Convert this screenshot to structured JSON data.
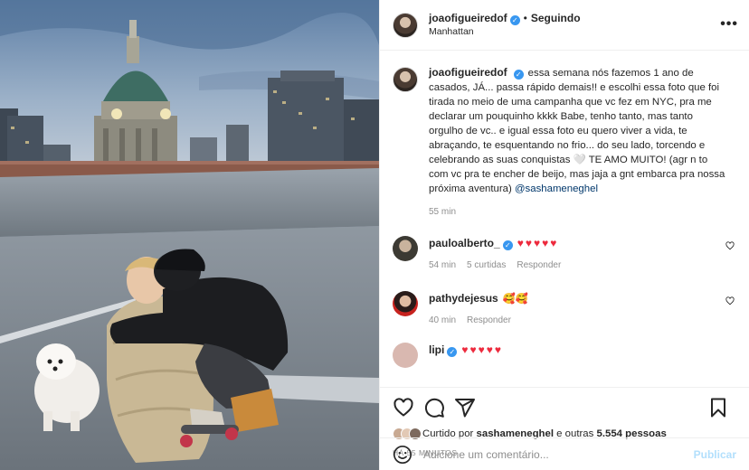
{
  "header": {
    "username": "joaofigueiredof",
    "separator": "•",
    "follow_status": "Seguindo",
    "location": "Manhattan",
    "more": "•••"
  },
  "caption": {
    "username": "joaofigueiredof",
    "text": "essa semana nós fazemos 1 ano de casados, JÁ... passa rápido demais!! e escolhi essa foto que foi tirada no meio de uma campanha que vc fez em NYC, pra me declarar um pouquinho kkkk Babe, tenho tanto, mas tanto orgulho de vc.. e igual essa foto eu quero viver a vida, te abraçando, te esquentando no frio... do seu lado, torcendo e celebrando as suas conquistas 🤍 TE AMO MUITO! (agr n to com vc pra te encher de beijo, mas jaja a gnt embarca pra nossa próxima aventura)",
    "mention": "@sashameneghel",
    "time": "55 min"
  },
  "comments": [
    {
      "username": "pauloalberto_",
      "text": "♥♥♥♥♥",
      "time": "54 min",
      "likes": "5 curtidas",
      "reply": "Responder"
    },
    {
      "username": "pathydejesus",
      "text": "🥰🥰",
      "time": "40 min",
      "reply": "Responder"
    },
    {
      "username": "lipi",
      "text": "♥♥♥♥♥"
    }
  ],
  "likes": {
    "prefix": "Curtido por",
    "user": "sashameneghel",
    "middle": "e outras",
    "count": "5.554 pessoas"
  },
  "timestamp": "HÁ 55 MINUTOS",
  "add_comment": {
    "placeholder": "Adicione um comentário...",
    "publish": "Publicar"
  },
  "colors": {
    "verified": "#3897f0",
    "mention": "#00376b",
    "publish_disabled": "#b2dffc",
    "muted": "#8e8e8e"
  }
}
